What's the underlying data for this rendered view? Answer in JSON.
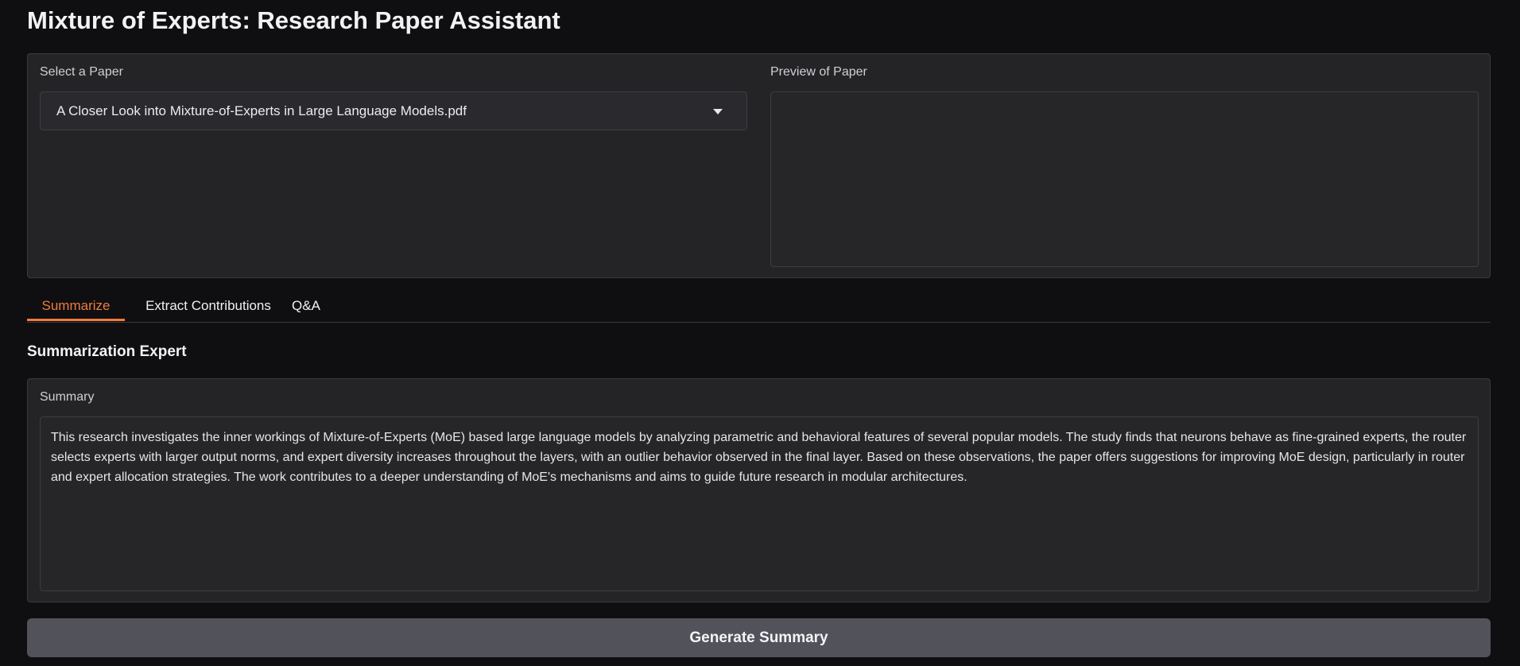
{
  "page": {
    "title": "Mixture of Experts: Research Paper Assistant"
  },
  "paper_select": {
    "label": "Select a Paper",
    "selected_value": "A Closer Look into Mixture-of-Experts in Large Language Models.pdf"
  },
  "preview": {
    "label": "Preview of Paper"
  },
  "tabs": [
    {
      "label": "Summarize",
      "active": true
    },
    {
      "label": "Extract Contributions",
      "active": false
    },
    {
      "label": "Q&A",
      "active": false
    }
  ],
  "summarize": {
    "heading": "Summarization Expert",
    "summary_label": "Summary",
    "summary_text": "This research investigates the inner workings of Mixture-of-Experts (MoE) based large language models by analyzing parametric and behavioral features of several popular models. The study finds that neurons behave as fine-grained experts, the router selects experts with larger output norms, and expert diversity increases throughout the layers, with an outlier behavior observed in the final layer. Based on these observations, the paper offers suggestions for improving MoE design, particularly in router and expert allocation strategies. The work contributes to a deeper understanding of MoE's mechanisms and aims to guide future research in modular architectures.",
    "generate_button_label": "Generate Summary"
  },
  "colors": {
    "background": "#0f0f11",
    "panel": "#242427",
    "accent": "#f07a3f",
    "button": "#52525b"
  }
}
